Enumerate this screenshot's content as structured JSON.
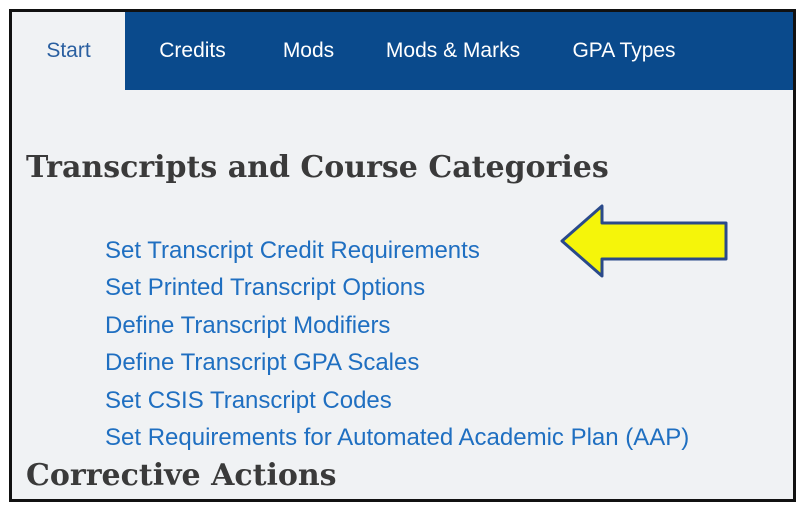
{
  "tabs": [
    {
      "label": "Start",
      "active": true
    },
    {
      "label": "Credits",
      "active": false
    },
    {
      "label": "Mods",
      "active": false
    },
    {
      "label": "Mods & Marks",
      "active": false
    },
    {
      "label": "GPA Types",
      "active": false
    }
  ],
  "sections": [
    {
      "title": "Transcripts and Course Categories",
      "links": [
        "Set Transcript Credit Requirements",
        "Set Printed Transcript Options",
        "Define Transcript Modifiers",
        "Define Transcript GPA Scales",
        "Set CSIS Transcript Codes",
        "Set Requirements for Automated Academic Plan (AAP)"
      ]
    },
    {
      "title": "Corrective Actions",
      "links": []
    }
  ],
  "annotation": {
    "type": "arrow-pointer-icon",
    "color": "#f5f50a",
    "outline": "#2a4a8a",
    "points_to": "Set Transcript Credit Requirements"
  },
  "colors": {
    "tabbar": "#0a4a8c",
    "link": "#1f6fc1",
    "background": "#f0f2f4"
  }
}
